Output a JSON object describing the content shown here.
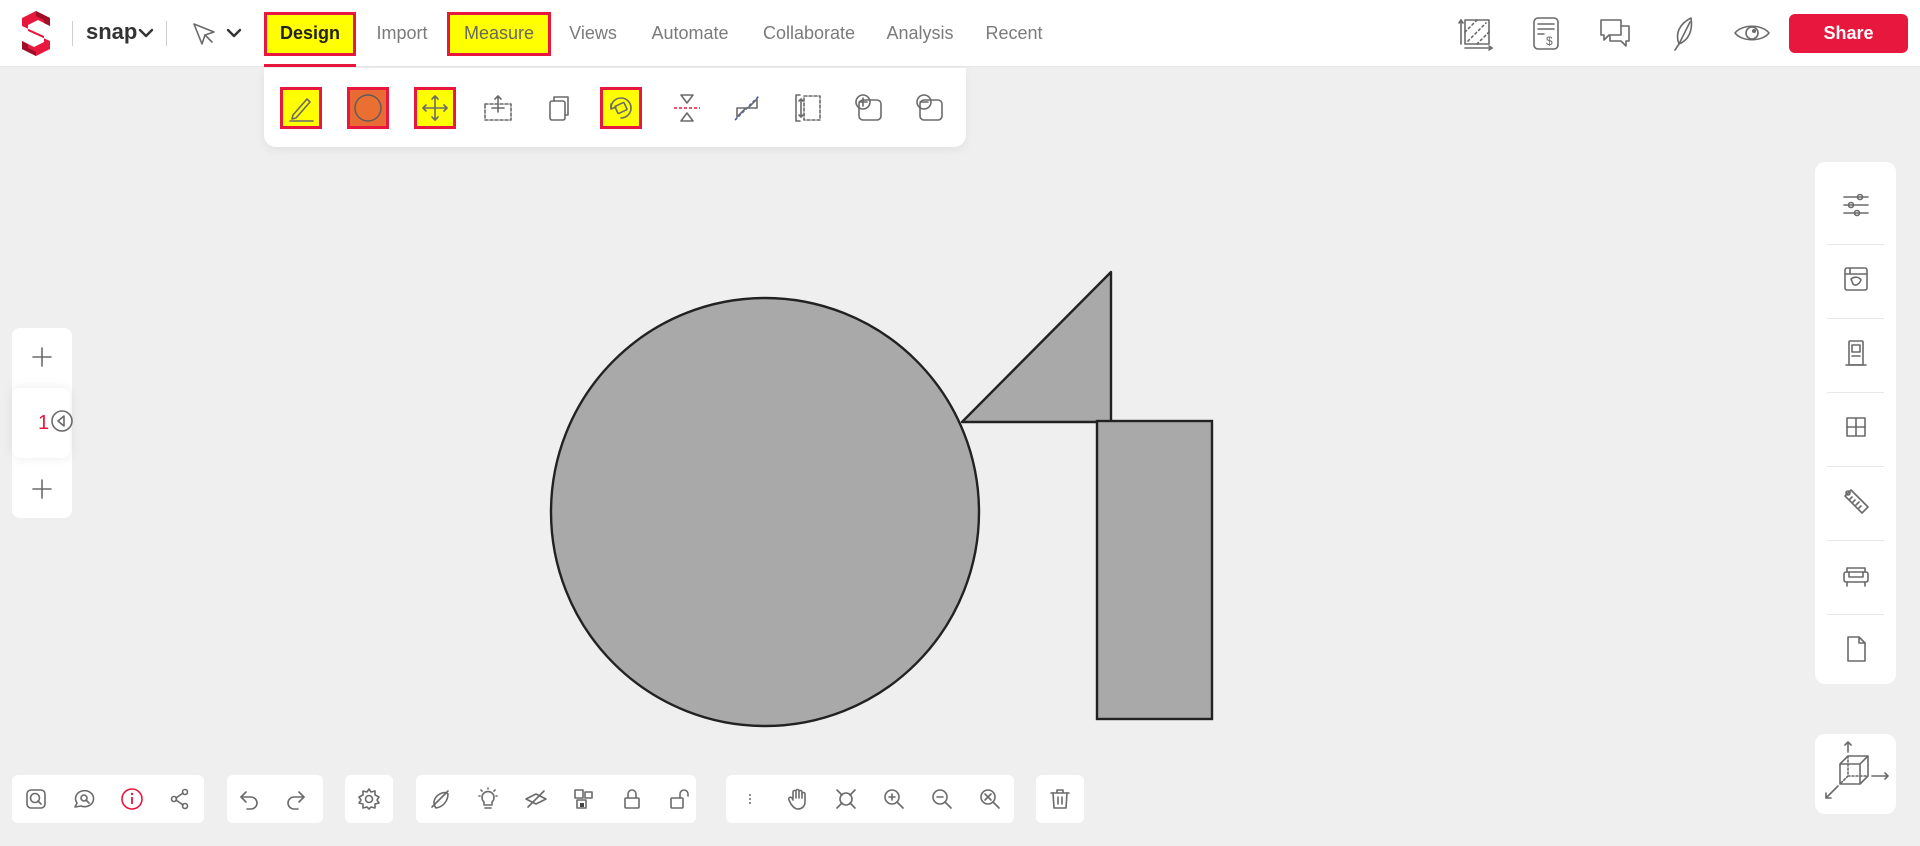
{
  "header": {
    "brand": "snap",
    "tabs": [
      {
        "label": "Design"
      },
      {
        "label": "Import"
      },
      {
        "label": "Measure"
      },
      {
        "label": "Views"
      },
      {
        "label": "Automate"
      },
      {
        "label": "Collaborate"
      },
      {
        "label": "Analysis"
      },
      {
        "label": "Recent"
      }
    ],
    "share_label": "Share",
    "right_icons": [
      "area-measure-icon",
      "cost-estimate-icon",
      "comments-icon",
      "sustainability-leaf-icon",
      "preview-eye-icon"
    ]
  },
  "design_toolbar": {
    "tools": [
      "draw-pencil-icon",
      "circle-shape-icon",
      "move-icon",
      "move-selection-icon",
      "copy-icon",
      "rotate-icon",
      "mirror-icon",
      "split-icon",
      "align-icon",
      "add-shape-icon",
      "remove-shape-icon"
    ]
  },
  "left_panel": {
    "page_number": "1"
  },
  "right_panel": {
    "items": [
      "settings-sliders-icon",
      "materials-paint-icon",
      "door-icon",
      "window-icon",
      "tape-measure-icon",
      "furniture-sofa-icon",
      "document-icon"
    ]
  },
  "bottom_toolbar": {
    "groups": [
      [
        "search-icon",
        "chat-search-icon",
        "info-icon",
        "share-nodes-icon"
      ],
      [
        "undo-icon",
        "redo-icon"
      ],
      [
        "settings-gear-icon"
      ],
      [
        "hide-icon",
        "light-bulb-icon",
        "layer-hide-icon",
        "group-icon",
        "lock-icon",
        "unlock-icon"
      ],
      [
        "more-vertical-icon",
        "pan-hand-icon",
        "fit-icon",
        "zoom-in-icon",
        "zoom-out-icon",
        "zoom-reset-icon"
      ],
      [
        "trash-icon"
      ]
    ]
  },
  "colors": {
    "accent": "#e8173d",
    "highlight": "#ffff00",
    "shape_fill": "#a9a9a9",
    "shape_stroke": "#222222",
    "canvas_bg": "#efeff0",
    "circle_tool_fill": "#e96a35"
  }
}
